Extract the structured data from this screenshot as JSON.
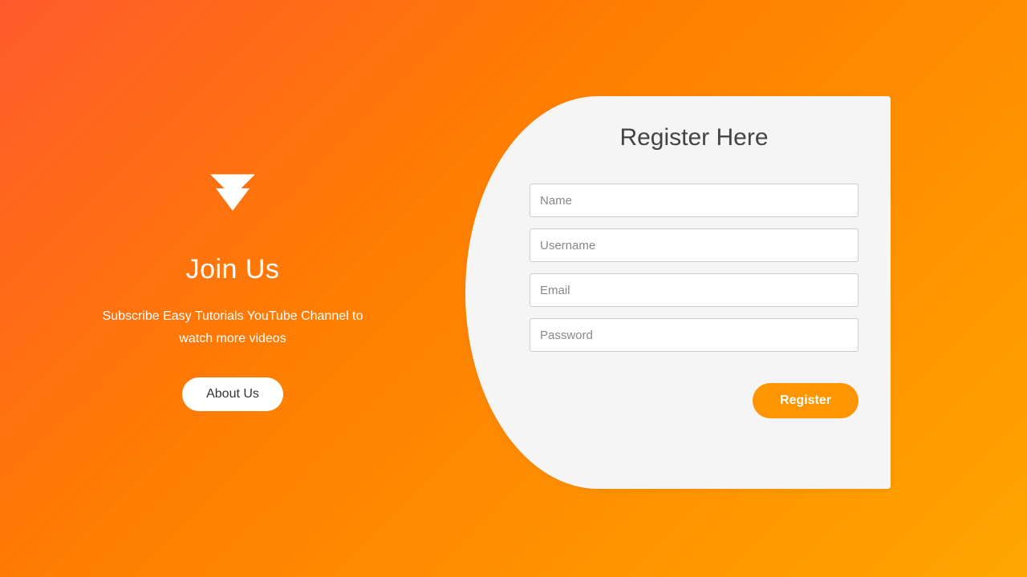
{
  "left": {
    "title": "Join Us",
    "subtitle": "Subscribe Easy Tutorials YouTube Channel to watch more videos",
    "about_label": "About Us"
  },
  "form": {
    "title": "Register Here",
    "name_placeholder": "Name",
    "username_placeholder": "Username",
    "email_placeholder": "Email",
    "password_placeholder": "Password",
    "submit_label": "Register"
  },
  "colors": {
    "gradient_start": "#ff5a2c",
    "gradient_end": "#ffa500",
    "button_accent": "#ff9500"
  }
}
